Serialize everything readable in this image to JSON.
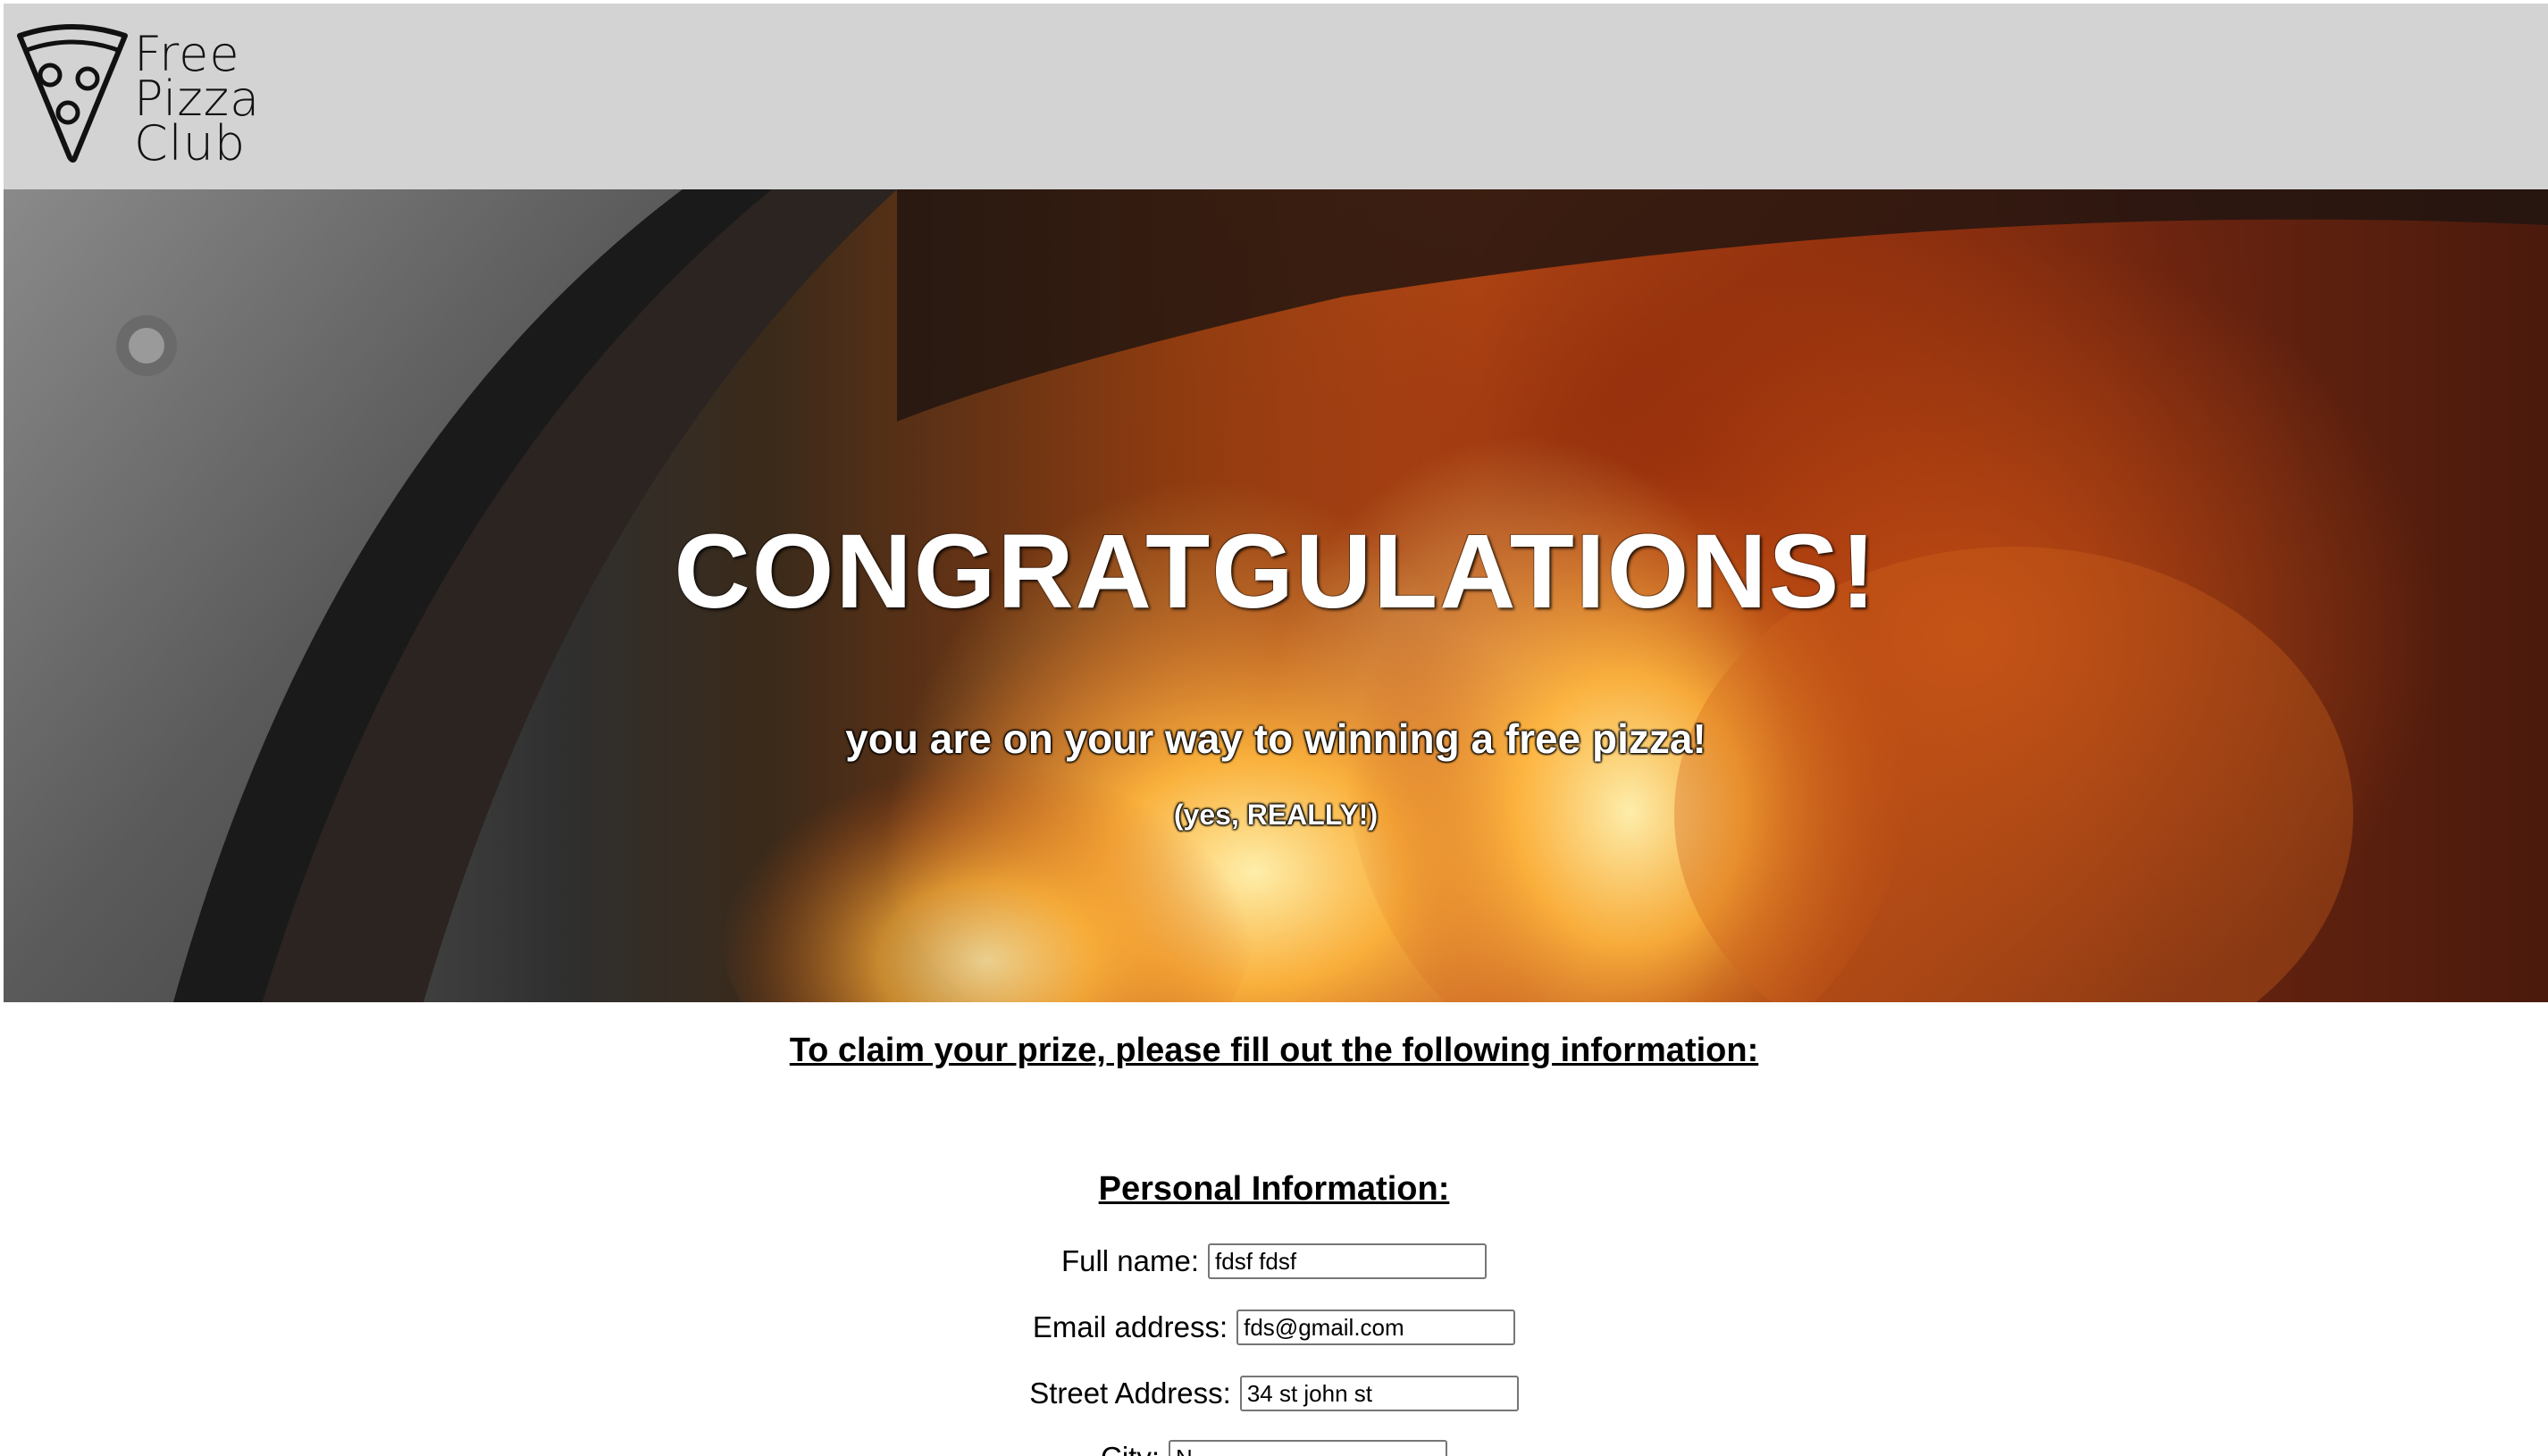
{
  "header": {
    "logo_lines": [
      "Free",
      "Pizza",
      "Club"
    ]
  },
  "hero": {
    "title": "CONGRATGULATIONS!",
    "subtitle": "you are on your way to winning a free pizza!",
    "note": "(yes, REALLY!)"
  },
  "form": {
    "intro": "To claim your prize, please fill out the following information:",
    "section_heading": "Personal Information:",
    "fields": [
      {
        "label": "Full name:",
        "value": "fdsf fdsf"
      },
      {
        "label": "Email address:",
        "value": "fds@gmail.com"
      },
      {
        "label": "Street Address:",
        "value": "34 st john st"
      },
      {
        "label": "City:",
        "value": "N"
      }
    ]
  }
}
